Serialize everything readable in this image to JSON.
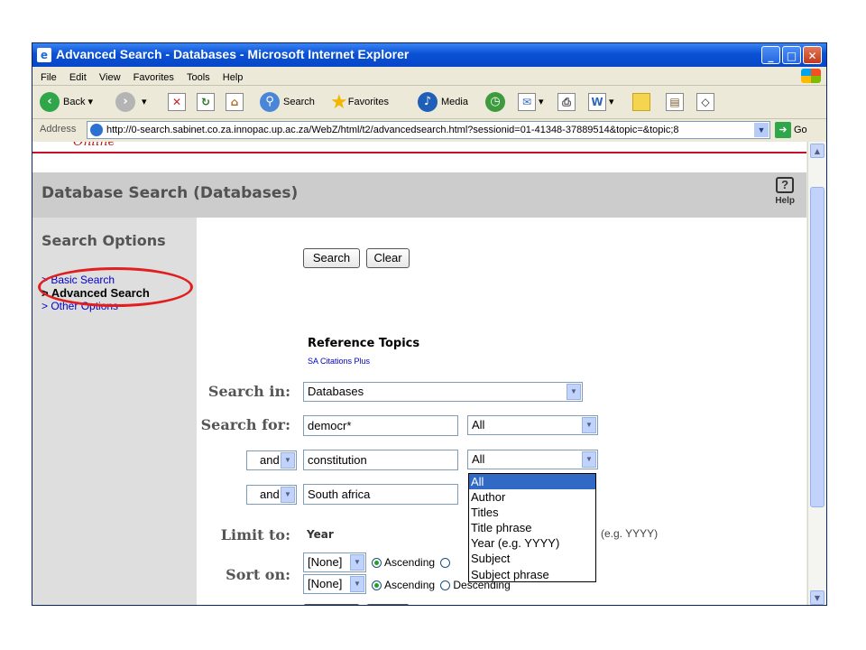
{
  "window": {
    "title": "Advanced Search - Databases - Microsoft Internet Explorer",
    "min_glyph": "_",
    "max_glyph": "□",
    "close_glyph": "✕"
  },
  "menu": [
    "File",
    "Edit",
    "View",
    "Favorites",
    "Tools",
    "Help"
  ],
  "toolbar": {
    "back": "Back",
    "search": "Search",
    "favorites": "Favorites",
    "media": "Media"
  },
  "address": {
    "label": "Address",
    "url": "http://0-search.sabinet.co.za.innopac.up.ac.za/WebZ/html/t2/advancedsearch.html?sessionid=01-41348-37889514&topic=&topic;8",
    "go": "Go"
  },
  "page": {
    "logo_text": "Online",
    "title": "Database Search (Databases)",
    "help": "Help",
    "help_glyph": "?",
    "search_options": "Search Options",
    "options": [
      "> Basic Search",
      "> Advanced Search",
      "> Other Options"
    ],
    "search_btn": "Search",
    "clear_btn": "Clear",
    "ref_title": "Reference Topics",
    "ref_link": "SA Citations Plus",
    "labels": {
      "search_in": "Search in:",
      "search_for": "Search for:",
      "limit_to": "Limit to:",
      "sort_on": "Sort on:"
    },
    "search_in_value": "Databases",
    "terms": [
      {
        "operator": "",
        "value": "democr*",
        "field": "All"
      },
      {
        "operator": "and",
        "value": "constitution",
        "field": "All"
      },
      {
        "operator": "and",
        "value": "South africa",
        "field": ""
      }
    ],
    "limit_value": "Year",
    "limit_hint": "(e.g. YYYY)",
    "sort": [
      {
        "field": "[None]",
        "asc": "Ascending",
        "desc": ""
      },
      {
        "field": "[None]",
        "asc": "Ascending",
        "desc": "Descending"
      }
    ],
    "dropdown_options": [
      "All",
      "Author",
      "Titles",
      "Title phrase",
      "Year (e.g. YYYY)",
      "Subject",
      "Subject phrase"
    ]
  }
}
